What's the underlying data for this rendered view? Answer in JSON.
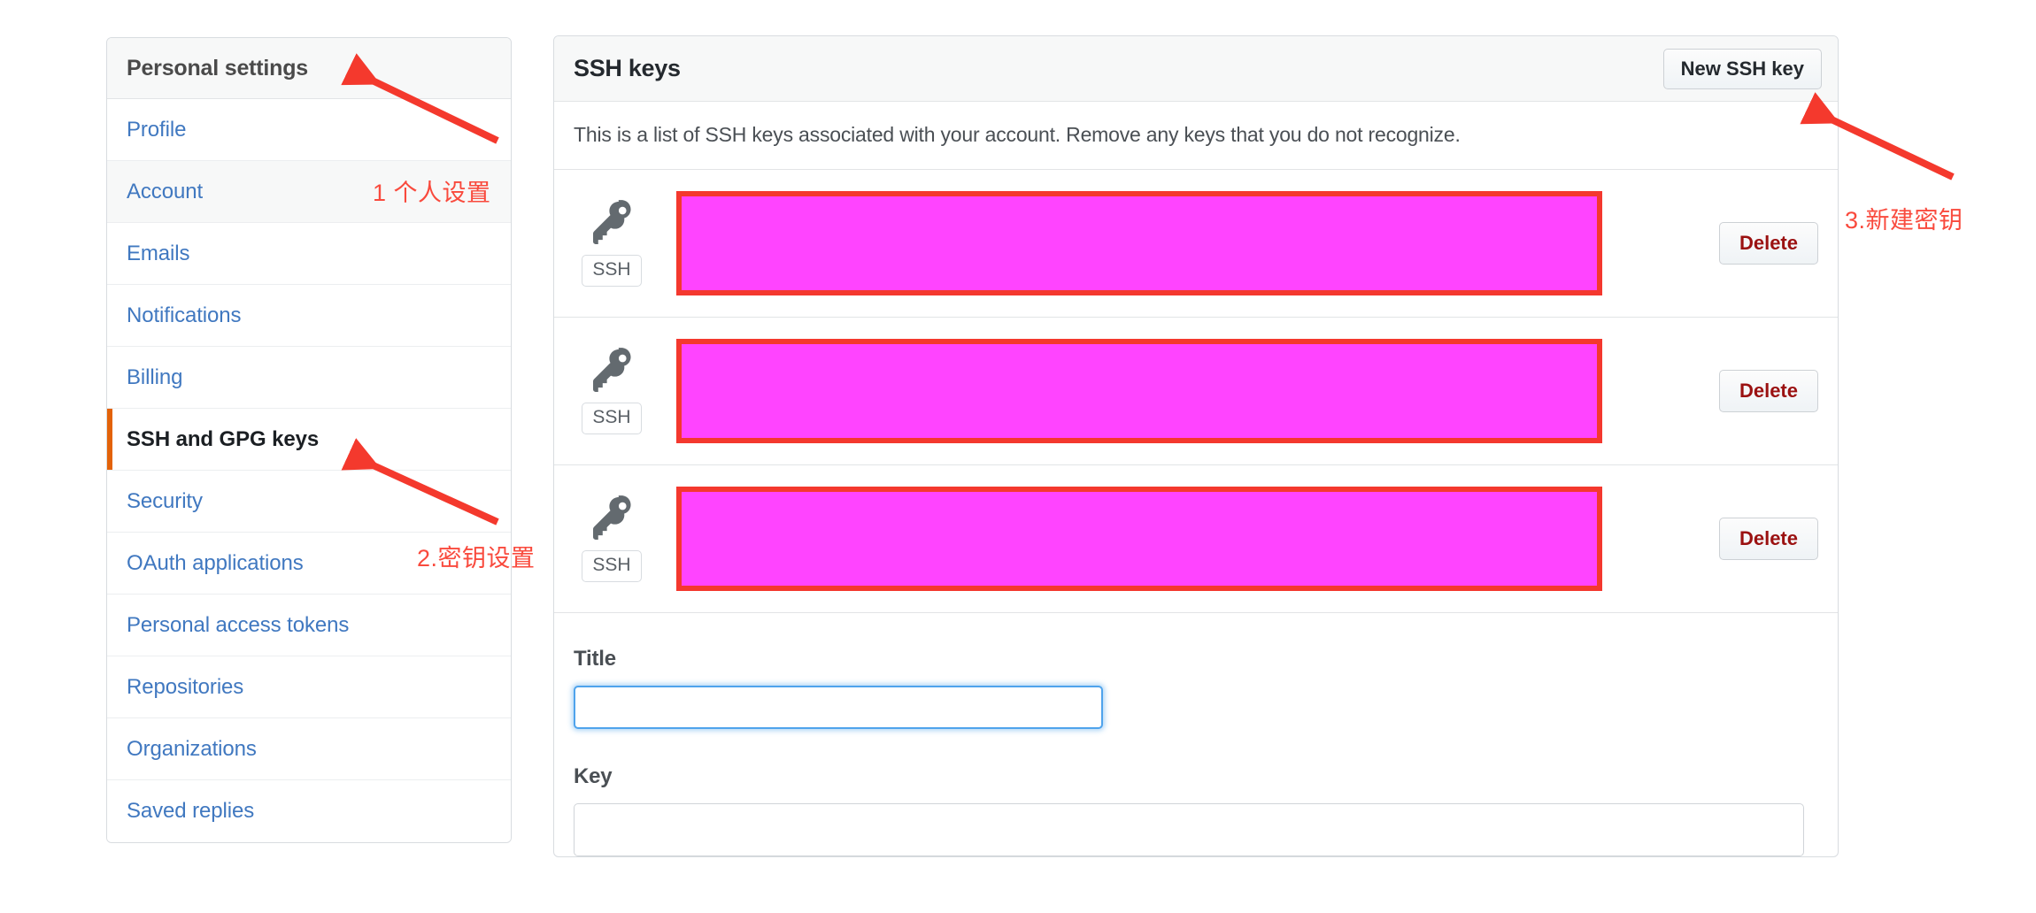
{
  "sidebar": {
    "header_title": "Personal settings",
    "items": [
      {
        "label": "Profile",
        "state": "normal"
      },
      {
        "label": "Account",
        "state": "hovered"
      },
      {
        "label": "Emails",
        "state": "normal"
      },
      {
        "label": "Notifications",
        "state": "normal"
      },
      {
        "label": "Billing",
        "state": "normal"
      },
      {
        "label": "SSH and GPG keys",
        "state": "selected"
      },
      {
        "label": "Security",
        "state": "normal"
      },
      {
        "label": "OAuth applications",
        "state": "normal"
      },
      {
        "label": "Personal access tokens",
        "state": "normal"
      },
      {
        "label": "Repositories",
        "state": "normal"
      },
      {
        "label": "Organizations",
        "state": "normal"
      },
      {
        "label": "Saved replies",
        "state": "normal"
      }
    ]
  },
  "main": {
    "heading": "SSH keys",
    "new_key_button": "New SSH key",
    "description": "This is a list of SSH keys associated with your account. Remove any keys that you do not recognize.",
    "keys": [
      {
        "badge": "SSH",
        "fingerprint_redacted": true,
        "delete_label": "Delete"
      },
      {
        "badge": "SSH",
        "fingerprint_redacted": true,
        "delete_label": "Delete"
      },
      {
        "badge": "SSH",
        "fingerprint_redacted": true,
        "delete_label": "Delete"
      }
    ],
    "form": {
      "title_label": "Title",
      "title_value": "",
      "title_placeholder": "",
      "key_label": "Key"
    }
  },
  "annotations": [
    {
      "id": "anno1",
      "text": "1 个人设置"
    },
    {
      "id": "anno2",
      "text": "2.密钥设置"
    },
    {
      "id": "anno3",
      "text": "3.新建密钥"
    }
  ],
  "colors": {
    "accent_link": "#4078c0",
    "selected_bar": "#e36209",
    "annotation_red": "#f94a3d",
    "redaction_fill": "#ff44ff",
    "redaction_border": "#f4382e",
    "danger_text": "#9b1111"
  }
}
